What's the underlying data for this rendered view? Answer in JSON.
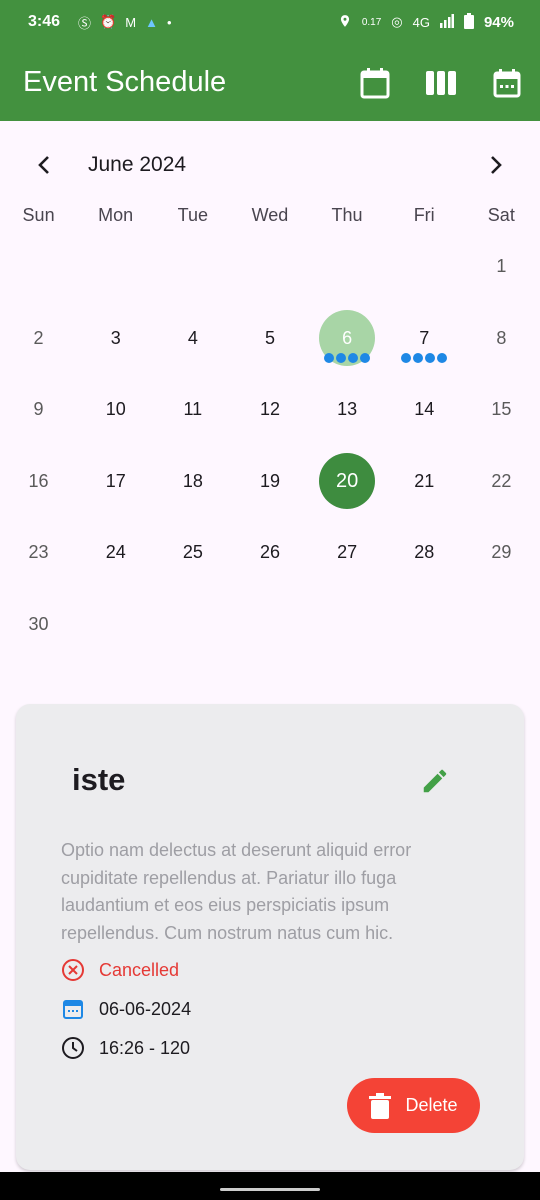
{
  "status_bar": {
    "time": "3:46",
    "battery": "94%",
    "network": "4G",
    "speed": "0.17",
    "speed_unit": "KB/s"
  },
  "app_bar": {
    "title": "Event Schedule",
    "actions": [
      "calendar-month-icon",
      "view-week-icon",
      "calendar-day-icon"
    ]
  },
  "calendar": {
    "month_label": "June 2024",
    "weekdays": [
      "Sun",
      "Mon",
      "Tue",
      "Wed",
      "Thu",
      "Fri",
      "Sat"
    ],
    "rows": [
      [
        "",
        "",
        "",
        "",
        "",
        "",
        "1"
      ],
      [
        "2",
        "3",
        "4",
        "5",
        "6",
        "7",
        "8"
      ],
      [
        "9",
        "10",
        "11",
        "12",
        "13",
        "14",
        "15"
      ],
      [
        "16",
        "17",
        "18",
        "19",
        "20",
        "21",
        "22"
      ],
      [
        "23",
        "24",
        "25",
        "26",
        "27",
        "28",
        "29"
      ],
      [
        "30",
        "",
        "",
        "",
        "",
        "",
        ""
      ]
    ],
    "selected_day": "6",
    "today": "20",
    "event_markers": {
      "6": 4,
      "7": 4
    },
    "colors": {
      "selected": "#A8D5A6",
      "today": "#3E8C3F",
      "marker": "#1E88E5"
    }
  },
  "event_card": {
    "title": "iste",
    "description": "Optio nam delectus at deserunt aliquid error cupiditate repellendus at. Pariatur illo fuga laudantium et eos eius perspiciatis ipsum repellendus. Cum nostrum natus cum hic.",
    "status": "Cancelled",
    "date": "06-06-2024",
    "time": "16:26 - 120",
    "delete_label": "Delete"
  },
  "colors": {
    "primary": "#43913F",
    "danger": "#F44336",
    "info": "#1E88E5"
  }
}
